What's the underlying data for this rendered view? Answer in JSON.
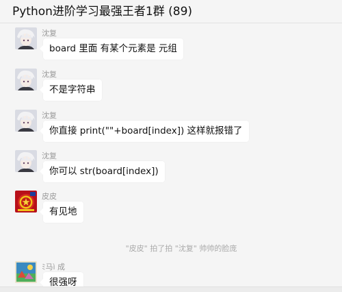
{
  "window": {
    "title": "Python进阶学习最强王者1群 (89)"
  },
  "messages": [
    {
      "sender": "沈复",
      "avatar": "anime-boy-avatar",
      "text": "board   里面 有某个元素是 元组"
    },
    {
      "sender": "沈复",
      "avatar": "anime-boy-avatar",
      "text": "不是字符串"
    },
    {
      "sender": "沈复",
      "avatar": "anime-boy-avatar",
      "text": "你直接 print(\"\"+board[index]) 这样就报错了"
    },
    {
      "sender": "沈复",
      "avatar": "anime-boy-avatar",
      "text": "你可以  str(board[index])"
    },
    {
      "sender": "皮皮",
      "avatar": "emblem-avatar",
      "text": "有见地"
    },
    {
      "sender": "ﾐ马ì 成",
      "avatar": "painting-avatar",
      "text": "很强呀"
    }
  ],
  "system_notice": "\"皮皮\" 拍了拍 \"沈复\" 帅帅的脸庞",
  "colors": {
    "background": "#f5f5f5",
    "bubble": "#ffffff",
    "meta_text": "#999999"
  }
}
